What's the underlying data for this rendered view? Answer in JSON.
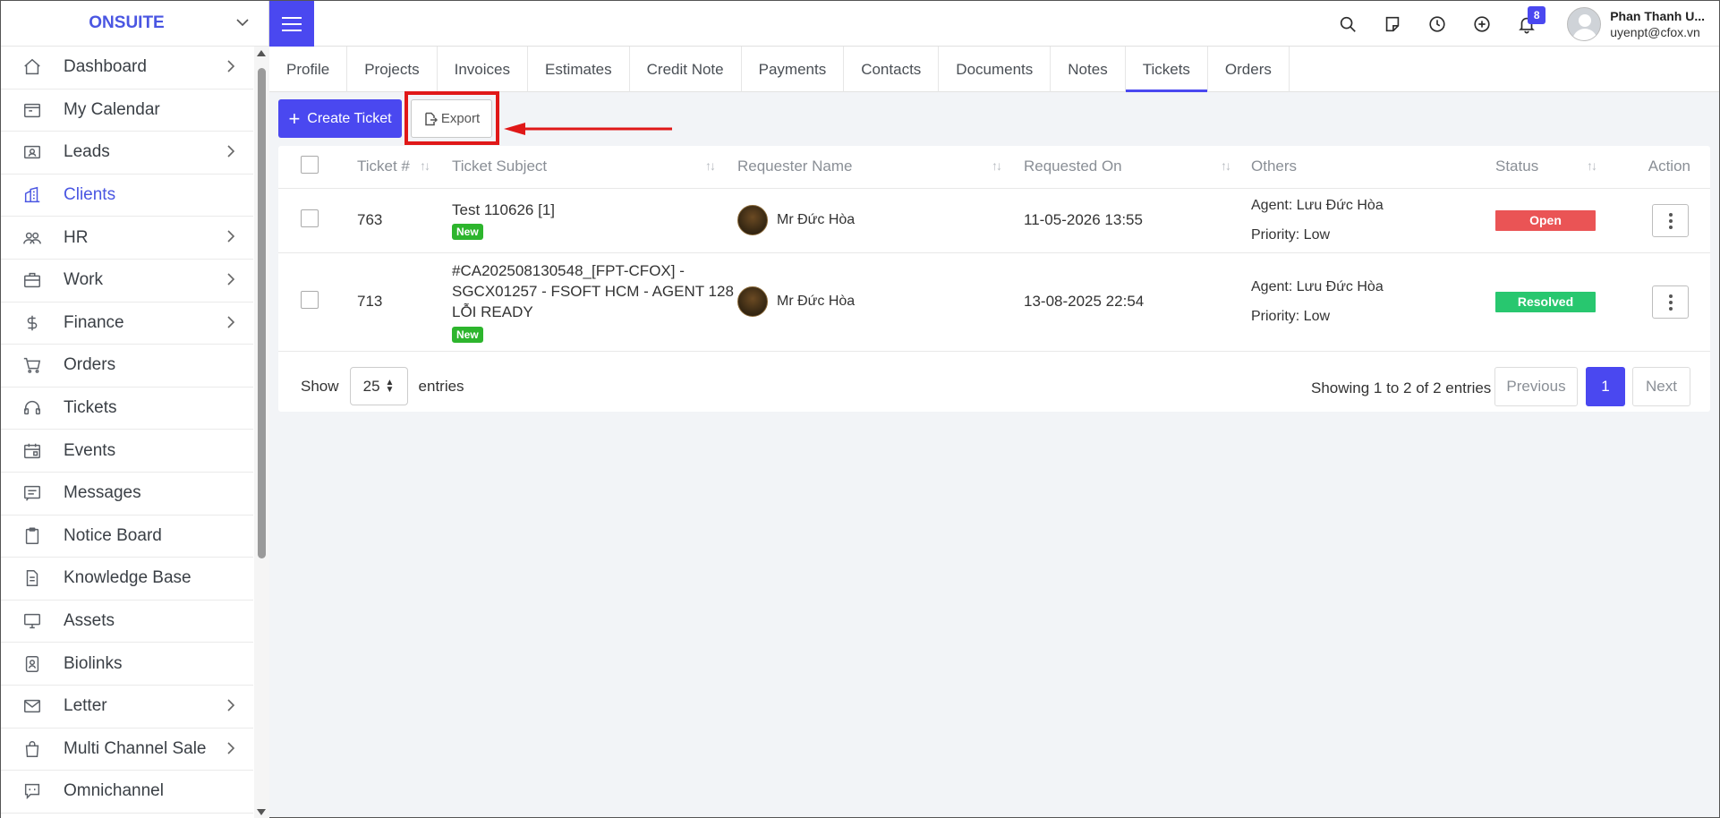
{
  "brand": {
    "name": "ONSUITE"
  },
  "sidebar": {
    "items": [
      {
        "label": "Dashboard",
        "icon": "home-icon",
        "has_arrow": true
      },
      {
        "label": "My Calendar",
        "icon": "calendar-icon",
        "has_arrow": false
      },
      {
        "label": "Leads",
        "icon": "id-card-icon",
        "has_arrow": true
      },
      {
        "label": "Clients",
        "icon": "building-icon",
        "has_arrow": false,
        "active": true
      },
      {
        "label": "HR",
        "icon": "people-icon",
        "has_arrow": true
      },
      {
        "label": "Work",
        "icon": "briefcase-icon",
        "has_arrow": true
      },
      {
        "label": "Finance",
        "icon": "dollar-icon",
        "has_arrow": true
      },
      {
        "label": "Orders",
        "icon": "cart-icon",
        "has_arrow": false
      },
      {
        "label": "Tickets",
        "icon": "headset-icon",
        "has_arrow": false
      },
      {
        "label": "Events",
        "icon": "event-calendar-icon",
        "has_arrow": false
      },
      {
        "label": "Messages",
        "icon": "message-icon",
        "has_arrow": false
      },
      {
        "label": "Notice Board",
        "icon": "clipboard-icon",
        "has_arrow": false
      },
      {
        "label": "Knowledge Base",
        "icon": "document-icon",
        "has_arrow": false
      },
      {
        "label": "Assets",
        "icon": "monitor-icon",
        "has_arrow": false
      },
      {
        "label": "Biolinks",
        "icon": "profile-badge-icon",
        "has_arrow": false
      },
      {
        "label": "Letter",
        "icon": "envelope-icon",
        "has_arrow": true
      },
      {
        "label": "Multi Channel Sale",
        "icon": "shopping-bag-icon",
        "has_arrow": true
      },
      {
        "label": "Omnichannel",
        "icon": "chat-icon",
        "has_arrow": false
      }
    ]
  },
  "topbar": {
    "notification_count": "8",
    "user_name": "Phan Thanh U...",
    "user_email": "uyenpt@cfox.vn"
  },
  "tabs": [
    "Profile",
    "Projects",
    "Invoices",
    "Estimates",
    "Credit Note",
    "Payments",
    "Contacts",
    "Documents",
    "Notes",
    "Tickets",
    "Orders"
  ],
  "active_tab": "Tickets",
  "actions": {
    "create_label": "Create Ticket",
    "export_label": "Export"
  },
  "table": {
    "headers": {
      "ticket": "Ticket #",
      "subject": "Ticket Subject",
      "requester": "Requester Name",
      "requested_on": "Requested On",
      "others": "Others",
      "status": "Status",
      "action": "Action"
    },
    "rows": [
      {
        "ticket": "763",
        "subject": "Test 110626 [1]",
        "tag": "New",
        "requester": "Mr Đức Hòa",
        "requested_on": "11-05-2026 13:55",
        "agent": "Agent: Lưu Đức Hòa",
        "priority": "Priority: Low",
        "status": "Open"
      },
      {
        "ticket": "713",
        "subject_lines": [
          "#CA202508130548_[FPT-CFOX] -",
          "SGCX01257 - FSOFT HCM - AGENT 128",
          "LỖI READY"
        ],
        "tag": "New",
        "requester": "Mr Đức Hòa",
        "requested_on": "13-08-2025 22:54",
        "agent": "Agent: Lưu Đức Hòa",
        "priority": "Priority: Low",
        "status": "Resolved"
      }
    ]
  },
  "footer": {
    "show": "Show",
    "page_size": "25",
    "entries": "entries",
    "info": "Showing 1 to 2 of 2 entries",
    "prev": "Previous",
    "current": "1",
    "next": "Next"
  },
  "colors": {
    "accent": "#4a48f0",
    "open": "#ea5455",
    "resolved": "#28c76f",
    "new_tag": "#2db52d",
    "highlight": "#e01818"
  }
}
